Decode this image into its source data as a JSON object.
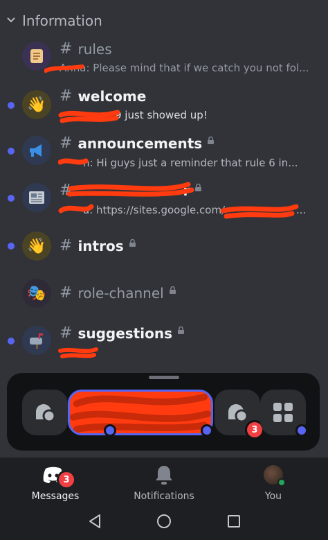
{
  "section": {
    "title": "Information"
  },
  "channels": [
    {
      "name": "rules",
      "preview": "Anna: Please mind that if we catch you not fol...",
      "unread": false,
      "locked": false,
      "icon": "scroll-icon"
    },
    {
      "name": "welcome",
      "preview": "9 just showed up!",
      "unread": true,
      "locked": false,
      "icon": "waving-hand-icon"
    },
    {
      "name": "announcements",
      "preview": "n: Hi guys just a reminder that rule 6 in...",
      "unread": true,
      "locked": true,
      "icon": "megaphone-icon"
    },
    {
      "name": "r",
      "preview": "a: https://sites.google.com/",
      "unread": true,
      "locked": true,
      "icon": "newspaper-icon"
    },
    {
      "name": "intros",
      "preview": "",
      "unread": true,
      "locked": true,
      "icon": "waving-hand-icon"
    },
    {
      "name": "role-channel",
      "preview": "",
      "unread": false,
      "locked": true,
      "icon": "theater-masks-icon"
    },
    {
      "name": "suggestions",
      "preview": "",
      "unread": true,
      "locked": true,
      "icon": "mailbox-icon"
    }
  ],
  "dock": {
    "dm_badge": "3"
  },
  "tabs": {
    "messages": {
      "label": "Messages",
      "badge": "3"
    },
    "notifications": {
      "label": "Notifications"
    },
    "you": {
      "label": "You"
    }
  },
  "colors": {
    "background": "#313338",
    "unread": "#5865f2",
    "badge": "#f23f43",
    "redaction": "#ff3b0f"
  }
}
